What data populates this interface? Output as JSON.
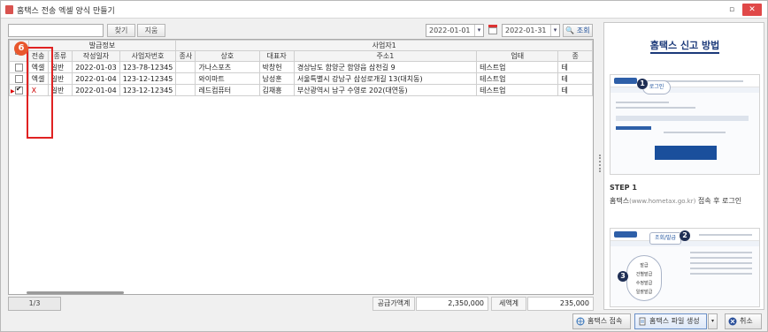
{
  "window": {
    "title": "홈택스 전송 엑셀 양식 만들기",
    "restore_label": "▫",
    "close_label": "✕"
  },
  "toolbar": {
    "search_value": "",
    "find_label": "찾기",
    "clear_label": "지움",
    "date_from": "2022-01-01",
    "date_to": "2022-01-31",
    "dropdown_glyph": "▾",
    "search_button": "🔍 조회"
  },
  "grid": {
    "group_headers": {
      "issue_info": "발급정보",
      "provider": "사업자1"
    },
    "columns": [
      "",
      "전송",
      "종류",
      "작성일자",
      "사업자번호",
      "종사",
      "상호",
      "대표자",
      "주소1",
      "업태",
      "종"
    ],
    "rows": [
      {
        "checked": false,
        "send": "엑셀",
        "type": "일반",
        "date": "2022-01-03",
        "bizno": "123-78-12345",
        "branch": "",
        "name": "가나스포츠",
        "ceo": "박창헌",
        "addr": "경상남도 함양군 함양읍 삼천길 9",
        "biz": "테스트업",
        "item": "테"
      },
      {
        "checked": false,
        "send": "엑셀",
        "type": "일반",
        "date": "2022-01-04",
        "bizno": "123-12-12345",
        "branch": "",
        "name": "와이마트",
        "ceo": "남성훈",
        "addr": "서울특별시 강남구 삼성로개길 13(대치동)",
        "biz": "테스트업",
        "item": "테"
      },
      {
        "checked": true,
        "send": "X",
        "type": "일반",
        "date": "2022-01-04",
        "bizno": "123-12-12345",
        "branch": "",
        "name": "레드컴퓨터",
        "ceo": "김채흥",
        "addr": "부산광역시 남구 수영로 202(대연동)",
        "biz": "테스트업",
        "item": "테"
      }
    ],
    "header_checked": true,
    "step_badge": "6"
  },
  "status": {
    "page": "1/3",
    "supply_label": "공급가액계",
    "supply_value": "2,350,000",
    "tax_label": "세액계",
    "tax_value": "235,000"
  },
  "bottom": {
    "hometax_connect": "홈택스 접속",
    "hometax_file": "홈택스 파일 생성",
    "split_glyph": "▾",
    "cancel": "취소"
  },
  "guide": {
    "title": "홈택스 신고 방법",
    "step1_label": "STEP 1",
    "step1_desc_a": "홈택스",
    "step1_url": "(www.hometax.go.kr)",
    "step1_desc_b": " 접속 후 로그인",
    "callout1": "로그인",
    "callout2": "조회/발급",
    "callout3_a": "발급",
    "callout3_b": "건별발급",
    "callout3_c": "수정발급",
    "callout3_d": "일괄발급",
    "num1": "1",
    "num2": "2",
    "num3": "3"
  },
  "colors": {
    "accent_red": "#e02222",
    "badge_orange": "#e8572d",
    "guide_blue": "#1c3a7a"
  }
}
